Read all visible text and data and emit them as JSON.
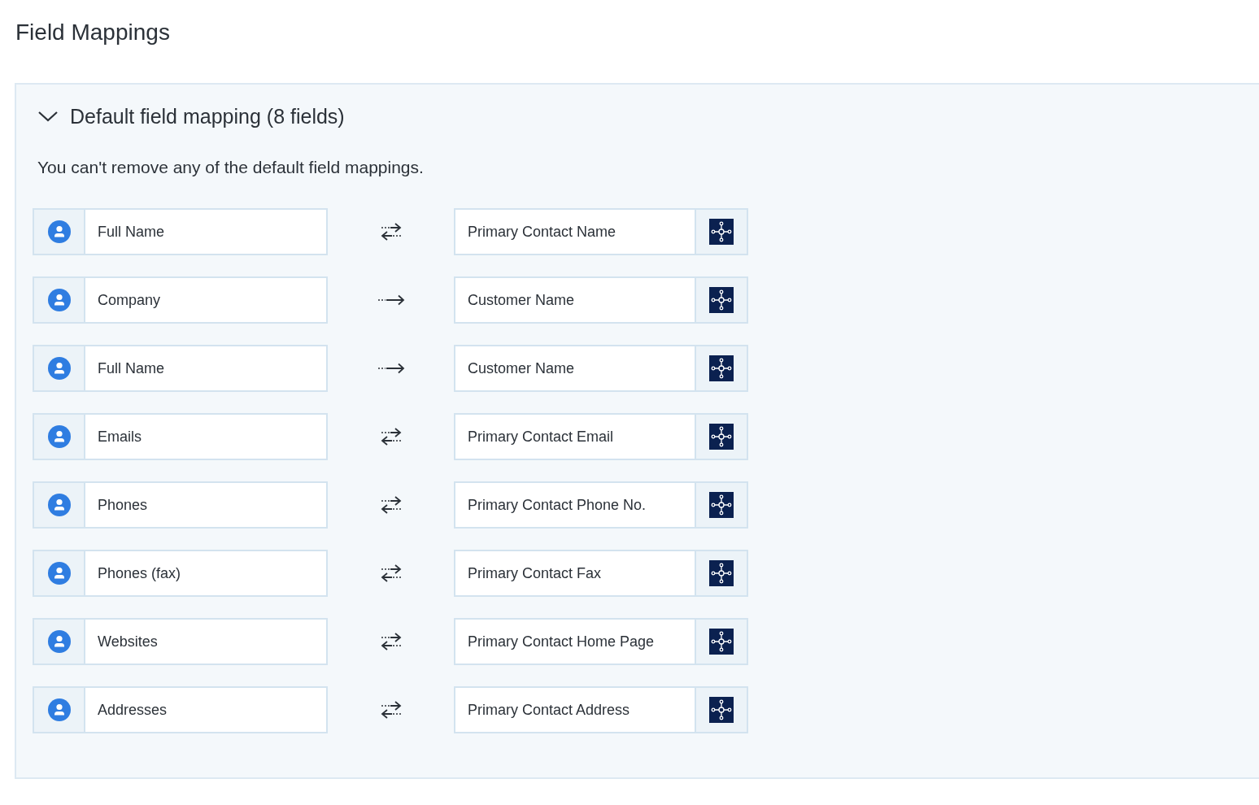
{
  "page_title": "Field Mappings",
  "section": {
    "title": "Default field mapping (8 fields)",
    "expanded": true,
    "note": "You can't remove any of the default field mappings.",
    "mappings": [
      {
        "source": "Full Name",
        "kind": "twoway",
        "target": "Primary Contact Name"
      },
      {
        "source": "Company",
        "kind": "oneway",
        "target": "Customer Name"
      },
      {
        "source": "Full Name",
        "kind": "oneway",
        "target": "Customer Name"
      },
      {
        "source": "Emails",
        "kind": "twoway",
        "target": "Primary Contact Email"
      },
      {
        "source": "Phones",
        "kind": "twoway",
        "target": "Primary Contact Phone No."
      },
      {
        "source": "Phones (fax)",
        "kind": "twoway",
        "target": "Primary Contact Fax"
      },
      {
        "source": "Websites",
        "kind": "twoway",
        "target": "Primary Contact Home Page"
      },
      {
        "source": "Addresses",
        "kind": "twoway",
        "target": "Primary Contact Address"
      }
    ]
  }
}
